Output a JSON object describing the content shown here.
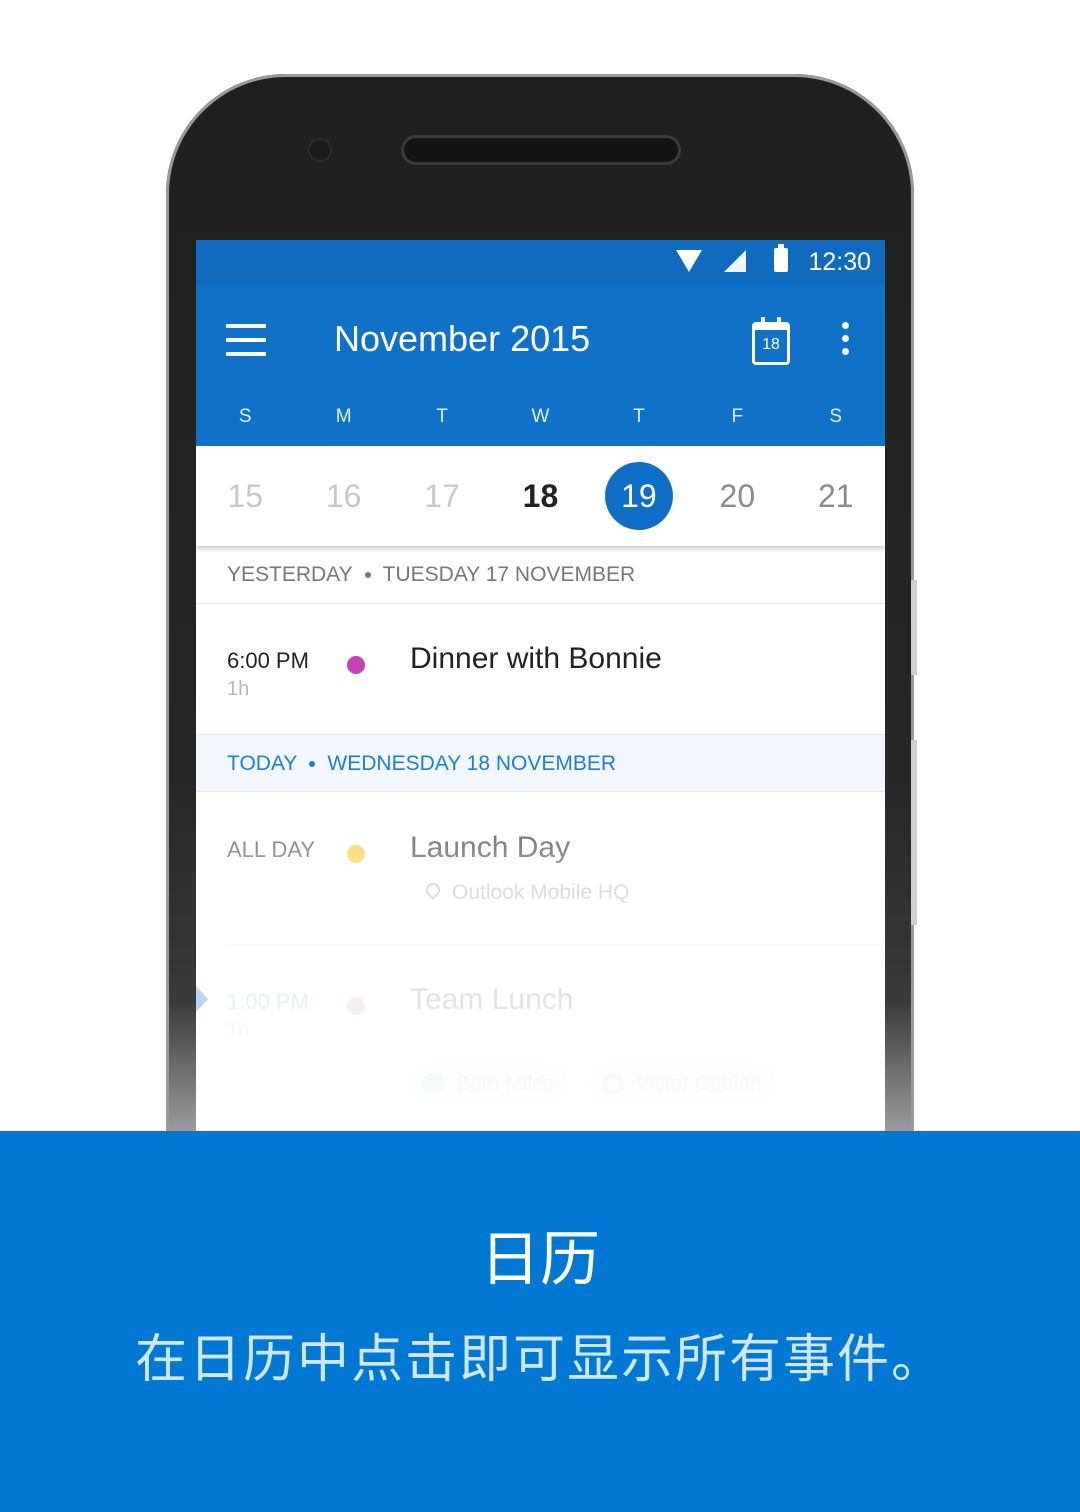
{
  "status_bar": {
    "time": "12:30",
    "icons": [
      "wifi-icon",
      "signal-icon",
      "battery-icon"
    ]
  },
  "app_bar": {
    "title": "November 2015",
    "menu_icon": "menu-icon",
    "today_button_day": "18",
    "more_icon": "more-vert-icon",
    "weekdays": [
      "S",
      "M",
      "T",
      "W",
      "T",
      "F",
      "S"
    ]
  },
  "day_strip": {
    "days": [
      "15",
      "16",
      "17",
      "18",
      "19",
      "20",
      "21"
    ],
    "today": "18",
    "selected": "19"
  },
  "agenda": {
    "yesterday_header": {
      "relative": "YESTERDAY",
      "date": "TUESDAY 17 NOVEMBER"
    },
    "today_header": {
      "relative": "TODAY",
      "date": "WEDNESDAY 18 NOVEMBER"
    },
    "events": [
      {
        "time": "6:00 PM",
        "duration": "1h",
        "title": "Dinner with Bonnie",
        "color": "#c444b8"
      },
      {
        "time": "ALL DAY",
        "duration": "",
        "title": "Launch Day",
        "location": "Outlook Mobile HQ",
        "color": "#f3cf3b"
      },
      {
        "time": "1:00 PM",
        "duration": "1h",
        "title": "Team Lunch",
        "color": "#d9b8e6",
        "attendees": [
          "Beth Miles",
          "Victor Coulon"
        ]
      }
    ]
  },
  "colors": {
    "brand_blue": "#0078d4",
    "appbar_blue": "#0f72c8",
    "status_blue": "#106bbf"
  },
  "banner": {
    "title": "日历",
    "subtitle": "在日历中点击即可显示所有事件。"
  }
}
